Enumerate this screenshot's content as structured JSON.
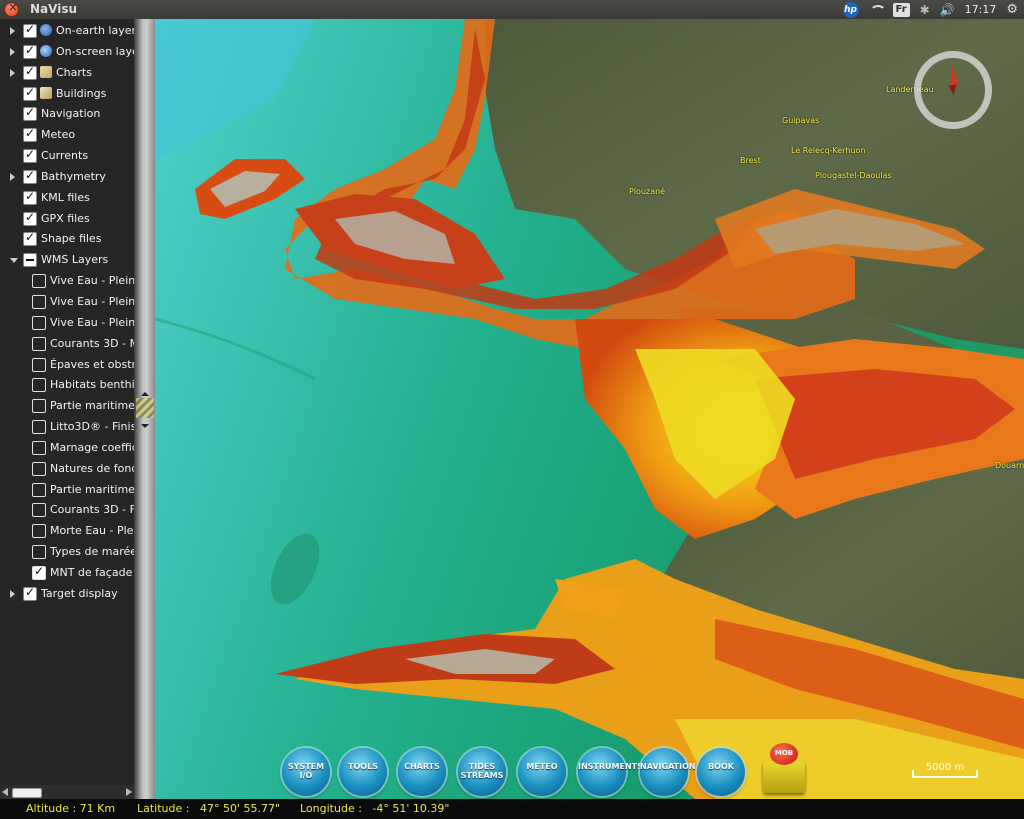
{
  "window": {
    "title": "NaVisu"
  },
  "tray": {
    "hp_label": "hp",
    "language": "Fr",
    "bluetooth": "✱",
    "volume": "🔊",
    "clock": "17:17",
    "gear": "⚙"
  },
  "layers": [
    {
      "label": "On-earth layer",
      "expander": "collapsed",
      "checked": "checked",
      "icon": "globe"
    },
    {
      "label": "On-screen laye",
      "expander": "collapsed",
      "checked": "checked",
      "icon": "screen"
    },
    {
      "label": "Charts",
      "expander": "collapsed",
      "checked": "checked",
      "icon": "chart"
    },
    {
      "label": "Buildings",
      "expander": "none",
      "checked": "checked",
      "icon": "building"
    },
    {
      "label": "Navigation",
      "expander": "none",
      "checked": "checked",
      "icon": ""
    },
    {
      "label": "Meteo",
      "expander": "none",
      "checked": "checked",
      "icon": ""
    },
    {
      "label": "Currents",
      "expander": "none",
      "checked": "checked",
      "icon": ""
    },
    {
      "label": "Bathymetry",
      "expander": "collapsed",
      "checked": "checked",
      "icon": ""
    },
    {
      "label": "KML files",
      "expander": "none",
      "checked": "checked",
      "icon": ""
    },
    {
      "label": "GPX files",
      "expander": "none",
      "checked": "checked",
      "icon": ""
    },
    {
      "label": "Shape files",
      "expander": "none",
      "checked": "checked",
      "icon": ""
    },
    {
      "label": "WMS Layers",
      "expander": "expanded",
      "checked": "partial",
      "icon": ""
    }
  ],
  "wms_layers": [
    {
      "label": "Vive Eau - Plein",
      "checked": false
    },
    {
      "label": "Vive Eau - Plein",
      "checked": false
    },
    {
      "label": "Vive Eau - Plein",
      "checked": false
    },
    {
      "label": "Courants 3D - M",
      "checked": false
    },
    {
      "label": "Épaves et obstr",
      "checked": false
    },
    {
      "label": "Habitats benthi",
      "checked": false
    },
    {
      "label": "Partie maritime",
      "checked": false
    },
    {
      "label": "Litto3D® - Finis",
      "checked": false
    },
    {
      "label": "Marnage coeffic",
      "checked": false
    },
    {
      "label": "Natures de fond",
      "checked": false
    },
    {
      "label": "Partie maritime",
      "checked": false
    },
    {
      "label": "Courants 3D - F",
      "checked": false
    },
    {
      "label": "Morte Eau - Ple",
      "checked": false
    },
    {
      "label": "Types de marée",
      "checked": false
    },
    {
      "label": "MNT de façade",
      "checked": true
    }
  ],
  "target_layer": {
    "label": "Target display",
    "checked": "checked"
  },
  "map": {
    "places": [
      {
        "name": "Landerneau"
      },
      {
        "name": "Guipavas"
      },
      {
        "name": "Le Relecq-Kerhuon"
      },
      {
        "name": "Brest"
      },
      {
        "name": "Plougastel-Daoulas"
      },
      {
        "name": "Plouzané"
      },
      {
        "name": "Douarn"
      }
    ],
    "scale_label": "5000 m"
  },
  "toolbar": [
    {
      "name": "system-io-button",
      "label": "SYSTEM I/O"
    },
    {
      "name": "tools-button",
      "label": "TOOLS"
    },
    {
      "name": "charts-button",
      "label": "CHARTS"
    },
    {
      "name": "tides-streams-button",
      "label": "TIDES STREAMS"
    },
    {
      "name": "meteo-button",
      "label": "METEO"
    },
    {
      "name": "instruments-button",
      "label": "INSTRUMENTS"
    },
    {
      "name": "navigation-button",
      "label": "NAVIGATION"
    },
    {
      "name": "book-button",
      "label": "BOOK"
    }
  ],
  "mob_label": "MOB",
  "status": {
    "altitude": "Altitude : 71 Km",
    "latitude": "Latitude :   47° 50' 55.77\"",
    "longitude": "Longitude :   -4° 51' 10.39\""
  }
}
